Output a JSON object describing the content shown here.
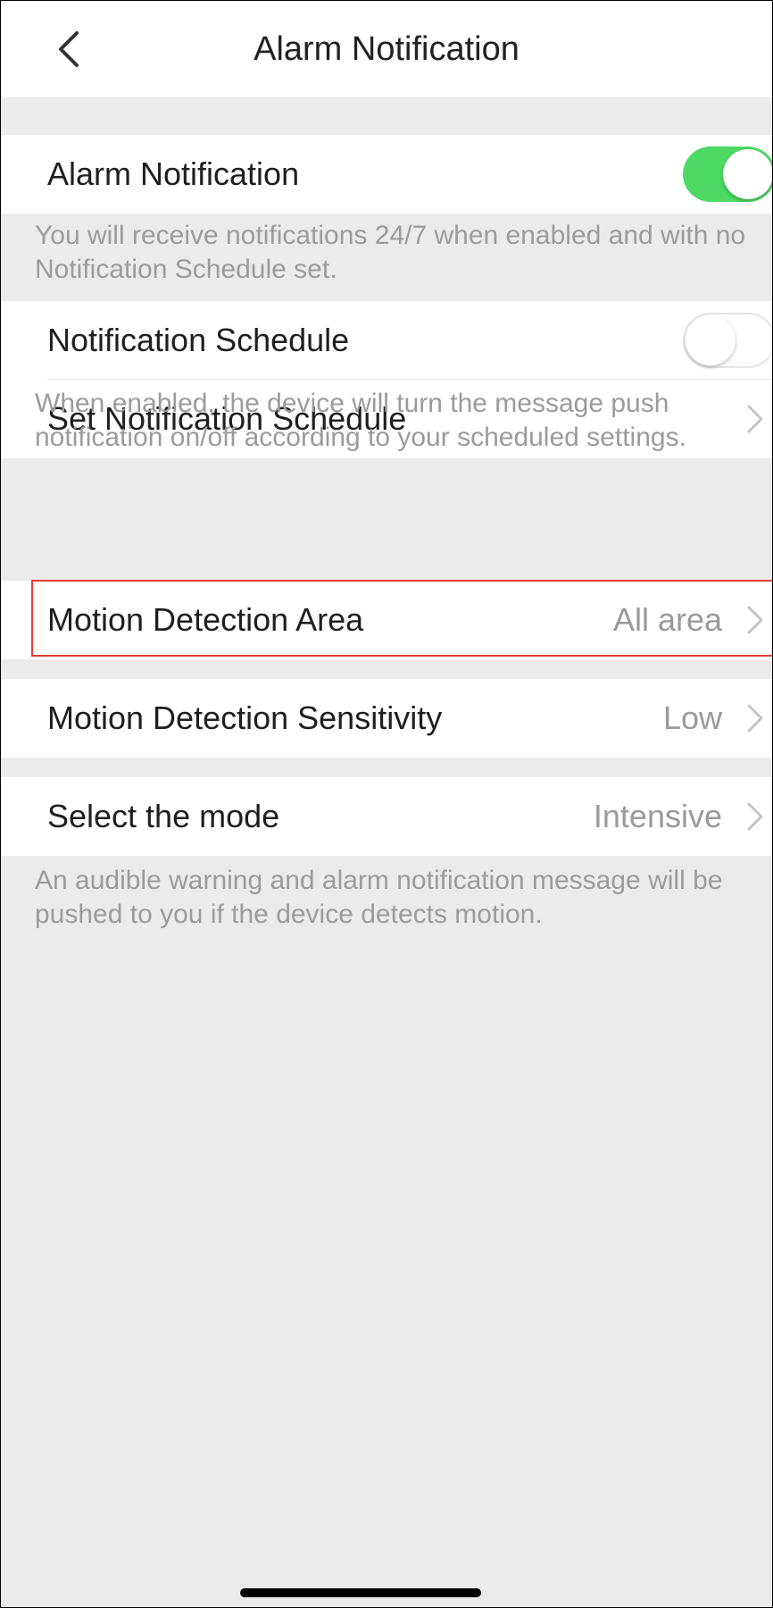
{
  "header": {
    "title": "Alarm Notification"
  },
  "alarm_section": {
    "label": "Alarm Notification",
    "enabled": true,
    "note": "You will receive notifications 24/7 when enabled and with no Notification Schedule set."
  },
  "schedule_section": {
    "toggle_label": "Notification Schedule",
    "enabled": false,
    "set_label": "Set Notification Schedule",
    "note": "When enabled, the device will turn the message push notification on/off according to your scheduled settings."
  },
  "motion_area": {
    "label": "Motion Detection Area",
    "value": "All area"
  },
  "motion_sensitivity": {
    "label": "Motion Detection Sensitivity",
    "value": "Low"
  },
  "mode": {
    "label": "Select the mode",
    "value": "Intensive",
    "note": "An audible warning and alarm notification message will be pushed to you if the device detects motion."
  },
  "colors": {
    "toggle_on": "#4cd964",
    "highlight": "#e53935",
    "background": "#ebebeb"
  }
}
